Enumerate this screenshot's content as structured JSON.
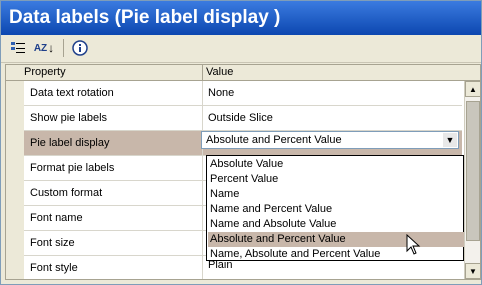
{
  "window": {
    "title": "Data labels (Pie label display )"
  },
  "toolbar": {
    "categorized_icon": "categorized-icon",
    "sort_az_icon": "sort-az-icon",
    "info_icon": "info-icon",
    "sort_label": "AZ"
  },
  "grid": {
    "headers": {
      "property": "Property",
      "value": "Value"
    },
    "rows": [
      {
        "property": "Data text rotation",
        "value": "None"
      },
      {
        "property": "Show pie labels",
        "value": "Outside Slice"
      },
      {
        "property": "Pie label display",
        "value": "Absolute and Percent Value"
      },
      {
        "property": "Format pie labels",
        "value": ""
      },
      {
        "property": "Custom format",
        "value": ""
      },
      {
        "property": "Font name",
        "value": ""
      },
      {
        "property": "Font size",
        "value": ""
      },
      {
        "property": "Font style",
        "value": "Plain"
      }
    ]
  },
  "dropdown": {
    "selected": "Absolute and Percent Value",
    "options": [
      "Absolute Value",
      "Percent Value",
      "Name",
      "Name and Percent Value",
      "Name and Absolute Value",
      "Absolute and Percent Value",
      "Name, Absolute and Percent Value"
    ]
  },
  "colors": {
    "title_bar": "#0c47b0",
    "selection": "#c8b7aa"
  }
}
